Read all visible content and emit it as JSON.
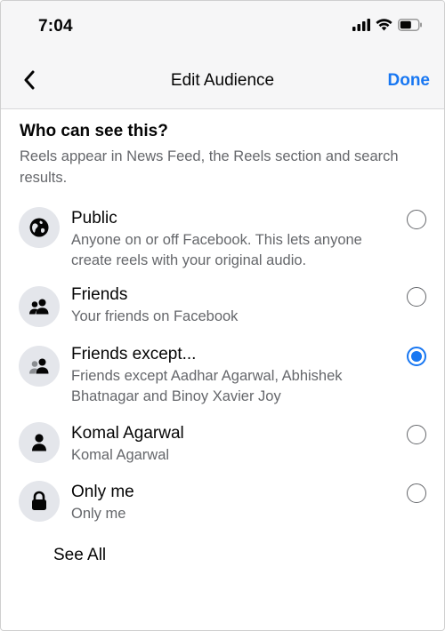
{
  "status_bar": {
    "time": "7:04"
  },
  "nav": {
    "title": "Edit Audience",
    "done_label": "Done"
  },
  "header": {
    "title": "Who can see this?",
    "subtitle": "Reels appear in News Feed, the Reels section and search results."
  },
  "options": [
    {
      "title": "Public",
      "description": "Anyone on or off Facebook. This lets anyone create reels with your original audio.",
      "icon": "globe-icon",
      "selected": false
    },
    {
      "title": "Friends",
      "description": "Your friends on Facebook",
      "icon": "friends-icon",
      "selected": false
    },
    {
      "title": "Friends except...",
      "description": "Friends except Aadhar Agarwal, Abhishek Bhatnagar and Binoy Xavier Joy",
      "icon": "friends-except-icon",
      "selected": true
    },
    {
      "title": "Komal Agarwal",
      "description": "Komal Agarwal",
      "icon": "person-icon",
      "selected": false
    },
    {
      "title": "Only me",
      "description": "Only me",
      "icon": "lock-icon",
      "selected": false
    }
  ],
  "see_all_label": "See All",
  "colors": {
    "accent": "#1877f2",
    "secondary_text": "#65676b",
    "icon_bg": "#e4e6eb"
  }
}
